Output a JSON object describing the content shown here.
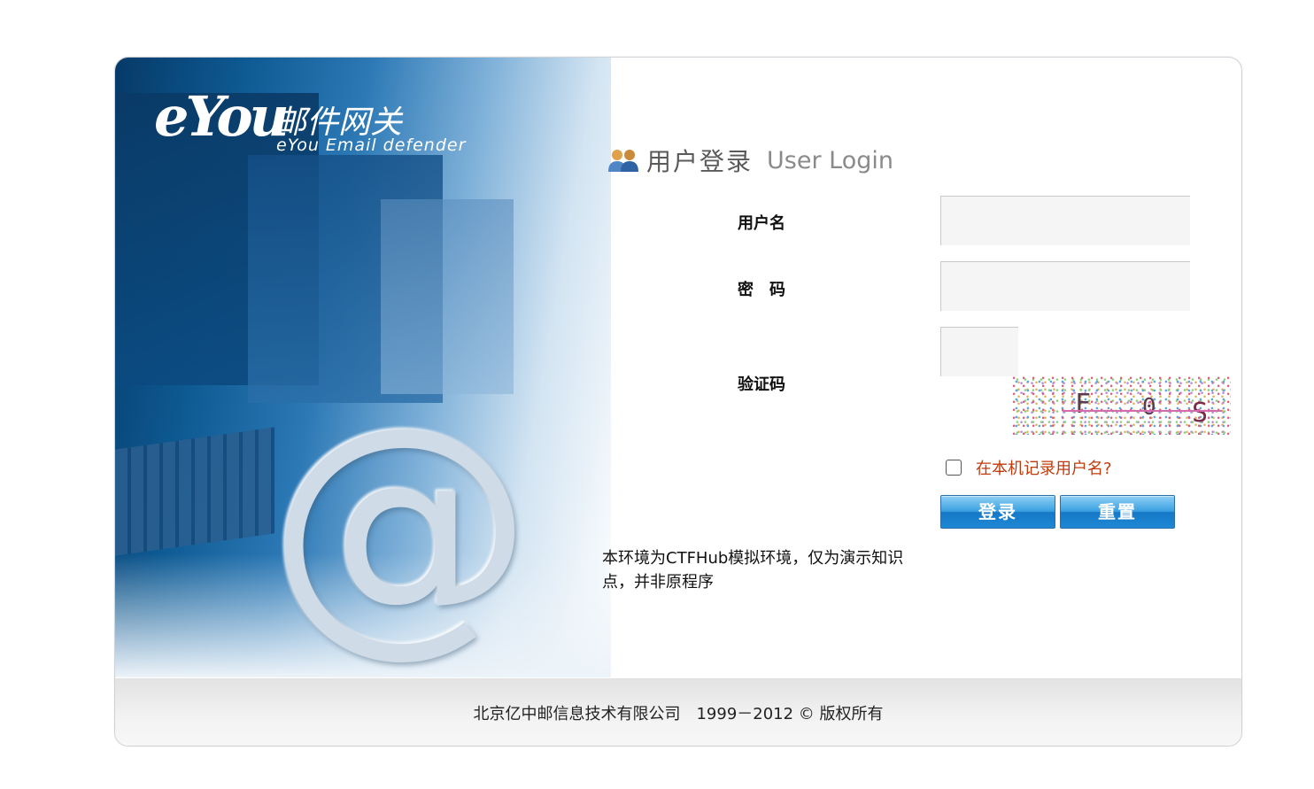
{
  "logo": {
    "brand": "eYou",
    "product_cn": "邮件网关",
    "product_en": "eYou Email defender"
  },
  "login": {
    "title_cn": "用户登录",
    "title_en": "User Login",
    "username_label": "用户名",
    "password_label": "密　码",
    "captcha_label": "验证码",
    "captcha_chars": [
      "F",
      "0",
      "S"
    ],
    "remember_label": "在本机记录用户名?",
    "login_button": "登录",
    "reset_button": "重置"
  },
  "notice": "本环境为CTFHub模拟环境，仅为演示知识点，并非原程序",
  "footer": "北京亿中邮信息技术有限公司　1999－2012 © 版权所有",
  "colors": {
    "remember_text": "#c03a0c",
    "button_blue": "#1e88d4"
  }
}
